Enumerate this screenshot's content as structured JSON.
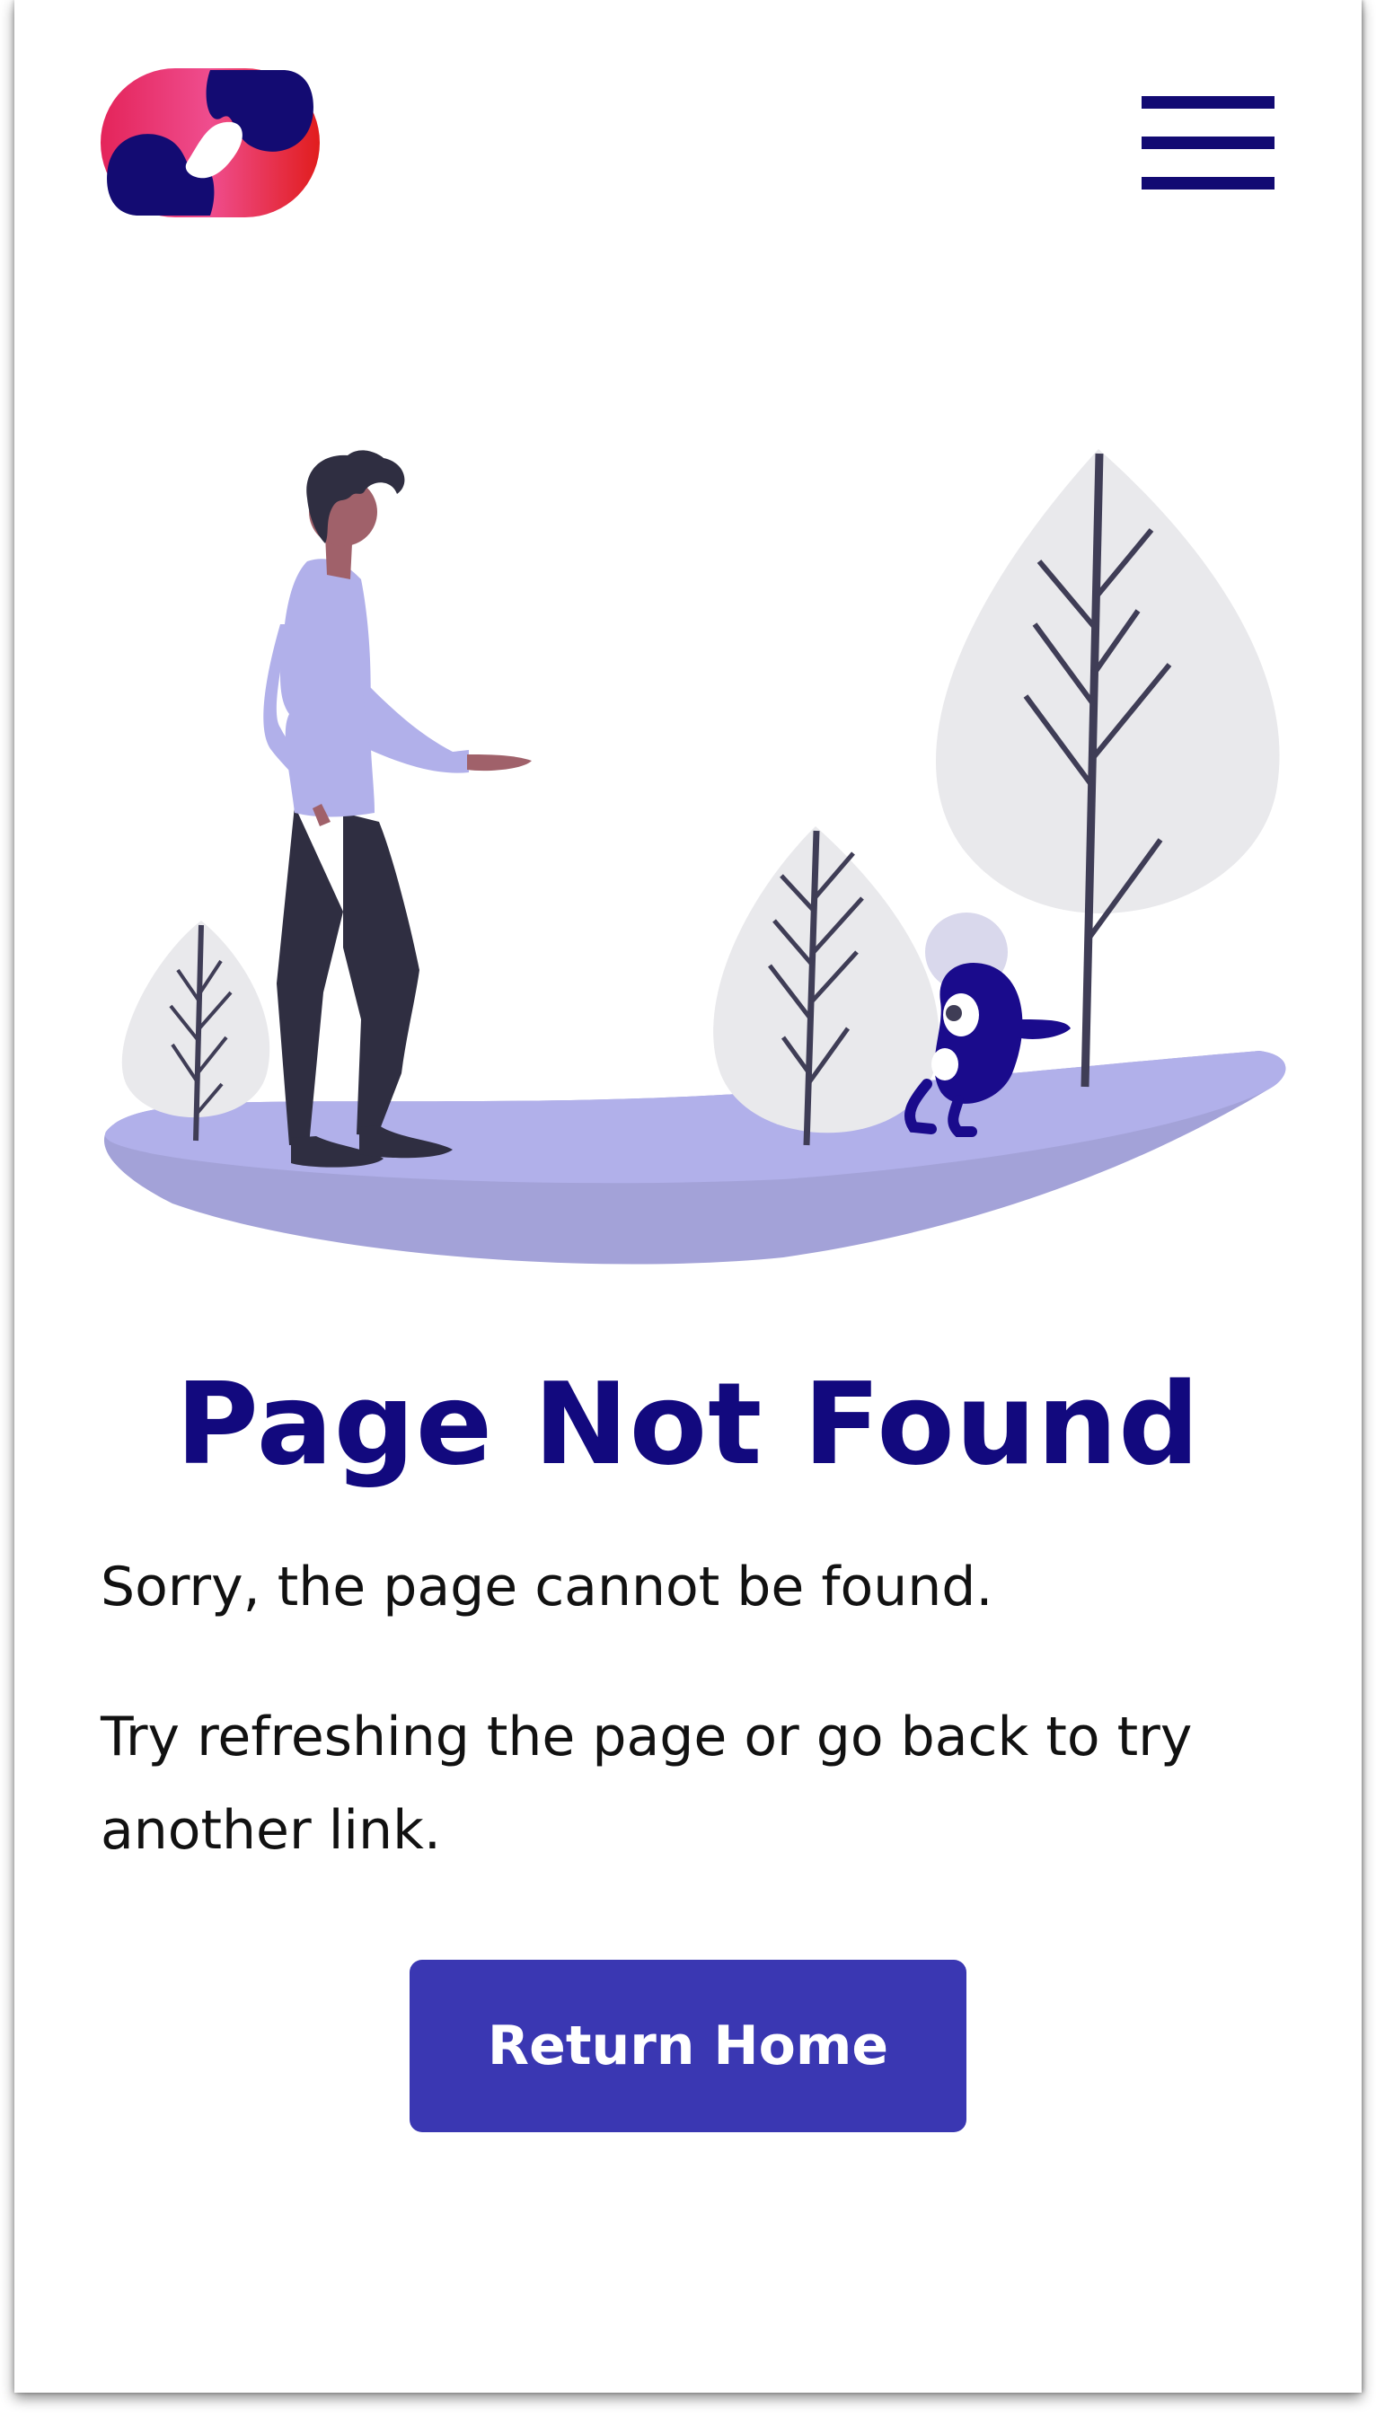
{
  "header": {
    "logo_icon": "brand-logo-icon",
    "menu_icon": "hamburger-menu-icon"
  },
  "illustration": {
    "description_icon": "person-with-trees-illustration"
  },
  "main": {
    "title": "Page Not Found",
    "message_1": "Sorry, the page cannot be found.",
    "message_2": "Try refreshing the page or go back to try another link.",
    "return_button": "Return Home"
  },
  "colors": {
    "primary": "#12097e",
    "button": "#3a37b2",
    "ground": "#b1b0ea",
    "tree_foliage": "#e9e9ec",
    "accent_pink": "#ef4d8e",
    "accent_red": "#e01f1f"
  }
}
